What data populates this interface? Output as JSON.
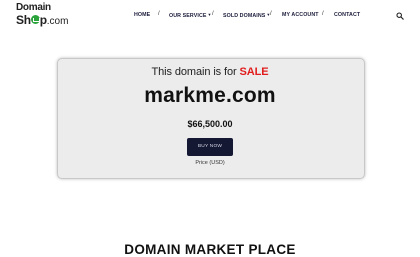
{
  "logo": {
    "line1": "Domain",
    "line2_main": "Sh",
    "line2_rest": "p",
    "line2_suffix": ".com"
  },
  "nav": {
    "items": [
      {
        "label": "HOME"
      },
      {
        "label": "OUR SERVICE"
      },
      {
        "label": "SOLD DOMAINS"
      },
      {
        "label": "MY ACCOUNT"
      },
      {
        "label": "CONTACT"
      }
    ],
    "separator": "/"
  },
  "icons": {
    "search": "search-icon",
    "logo_cart": "cart-icon",
    "dropdown": "chevron-down-icon"
  },
  "sale": {
    "heading_prefix": "This domain is for ",
    "heading_highlight": "SALE",
    "domain": "markme.com",
    "price": "$66,500.00",
    "buy_label": "BUY NOW",
    "price_label": "Price (USD)"
  },
  "section": {
    "title": "DOMAIN MARKET PLACE"
  },
  "colors": {
    "accent_red": "#e21c1c",
    "button_bg": "#141833",
    "logo_green": "#2aa33a",
    "nav_text": "#1b1b3a"
  }
}
